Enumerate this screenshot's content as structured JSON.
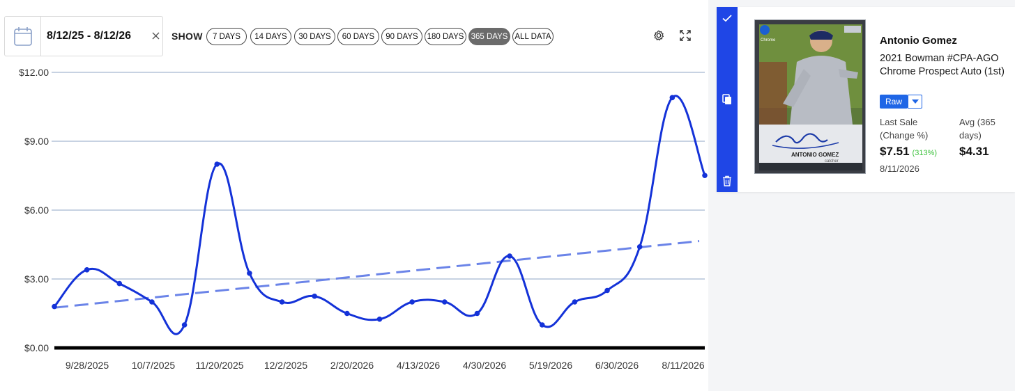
{
  "toolbar": {
    "date_range": "8/12/25 - 8/12/26",
    "show_label": "SHOW",
    "ranges": [
      {
        "label": "7 DAYS",
        "active": false
      },
      {
        "label": "14 DAYS",
        "active": false
      },
      {
        "label": "30 DAYS",
        "active": false
      },
      {
        "label": "60 DAYS",
        "active": false
      },
      {
        "label": "90 DAYS",
        "active": false
      },
      {
        "label": "180 DAYS",
        "active": false
      },
      {
        "label": "365 DAYS",
        "active": true
      },
      {
        "label": "ALL DATA",
        "active": false
      }
    ],
    "icons": [
      "calendar-icon",
      "close-icon",
      "gear-icon",
      "expand-icon"
    ]
  },
  "chart_data": {
    "type": "line",
    "ylim": [
      0,
      12
    ],
    "yticks": [
      0,
      3,
      6,
      9,
      12
    ],
    "ytick_labels": [
      "$0.00",
      "$3.00",
      "$6.00",
      "$9.00",
      "$12.00"
    ],
    "xtick_labels": [
      "9/28/2025",
      "10/7/2025",
      "11/20/2025",
      "12/2/2025",
      "2/20/2026",
      "4/13/2026",
      "4/30/2026",
      "5/19/2026",
      "6/30/2026",
      "8/11/2026"
    ],
    "series": [
      {
        "values": [
          1.8,
          3.4,
          2.8,
          2.0,
          1.0,
          8.0,
          3.25,
          2.0,
          2.25,
          1.5,
          1.25,
          2.0,
          2.0,
          1.5,
          4.0,
          1.0,
          2.0,
          2.5,
          4.4,
          10.9,
          7.51
        ]
      }
    ],
    "trendline": {
      "start": 1.75,
      "end": 4.65
    },
    "colors": {
      "line": "#1432d8",
      "trend": "#6b84e8",
      "grid": "#8fa4c4",
      "baseline": "#000000"
    },
    "grid": true,
    "legend": "none"
  },
  "sidebar_icons": [
    "check-icon",
    "copy-icon",
    "trash-icon"
  ],
  "card": {
    "player": "Antonio Gomez",
    "title": "2021 Bowman #CPA-AGO Chrome Prospect Auto (1st)",
    "grade_button": "Raw",
    "last_sale_label": "Last Sale (Change %)",
    "last_sale_value": "$7.51",
    "change": "(313%)",
    "avg_label": "Avg (365 days)",
    "avg_value": "$4.31",
    "sale_date": "8/11/2026",
    "image_text": {
      "brand": "Chrome",
      "name": "ANTONIO GOMEZ",
      "position": "catcher"
    }
  },
  "colors": {
    "accent": "#1f46e6",
    "raw_button": "#1f66e6",
    "positive": "#3cc13c"
  }
}
